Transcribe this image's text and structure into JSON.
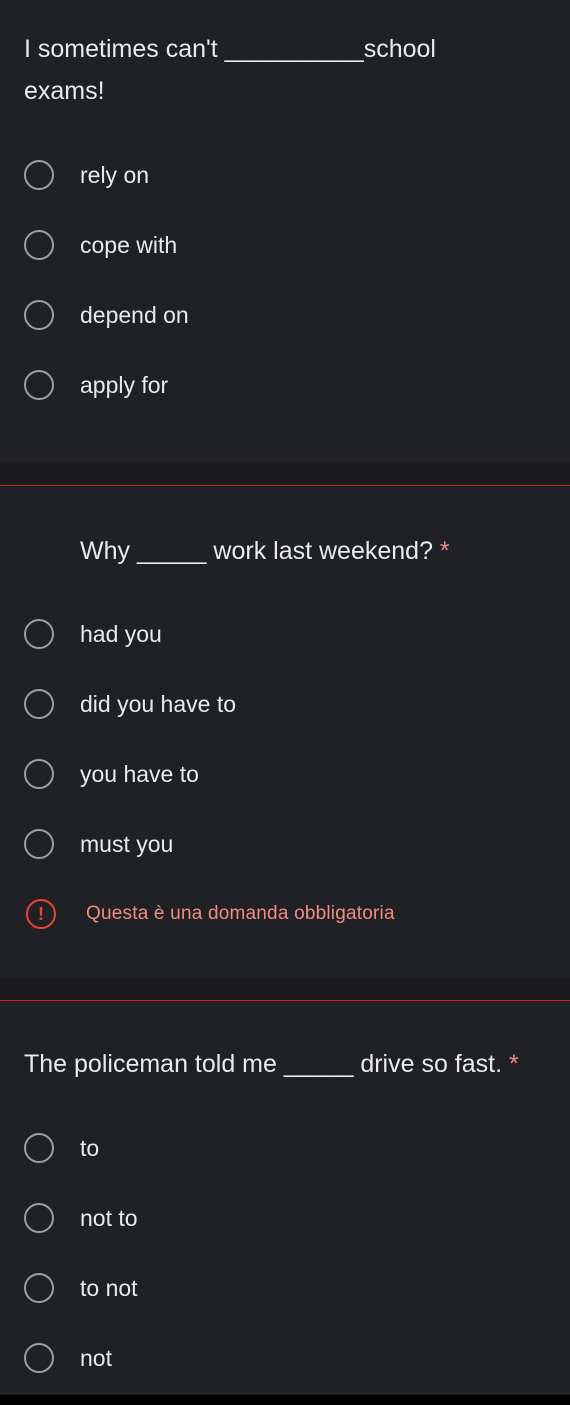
{
  "questions": [
    {
      "text": "I sometimes can't __________school exams!",
      "required_mark": "",
      "options": [
        "rely on",
        "cope with",
        "depend on",
        "apply for"
      ],
      "error": ""
    },
    {
      "text": "Why _____ work last weekend?",
      "required_mark": "*",
      "options": [
        "had you",
        "did you have to",
        "you have to",
        "must you"
      ],
      "error": "Questa è una domanda obbligatoria"
    },
    {
      "text": "The policeman told me _____ drive so fast.",
      "required_mark": "*",
      "options": [
        "to",
        "not to",
        "to not",
        "not"
      ],
      "error": ""
    }
  ],
  "colors": {
    "background": "#202124",
    "error": "#ea4335",
    "error_text": "#f28b82",
    "text": "#e8eaed"
  }
}
